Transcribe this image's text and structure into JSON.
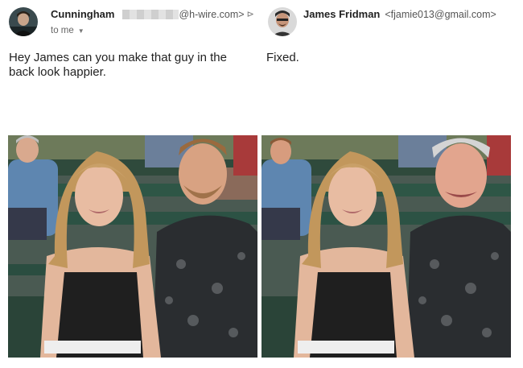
{
  "left_email": {
    "sender_name": "Cunningham",
    "sender_email": "@h-wire.com>",
    "recipient": "to me",
    "body": "Hey James can you make that guy in the back look happier."
  },
  "right_email": {
    "sender_name": "James Fridman",
    "sender_email": "<fjamie013@gmail.com>",
    "body": "Fixed."
  }
}
